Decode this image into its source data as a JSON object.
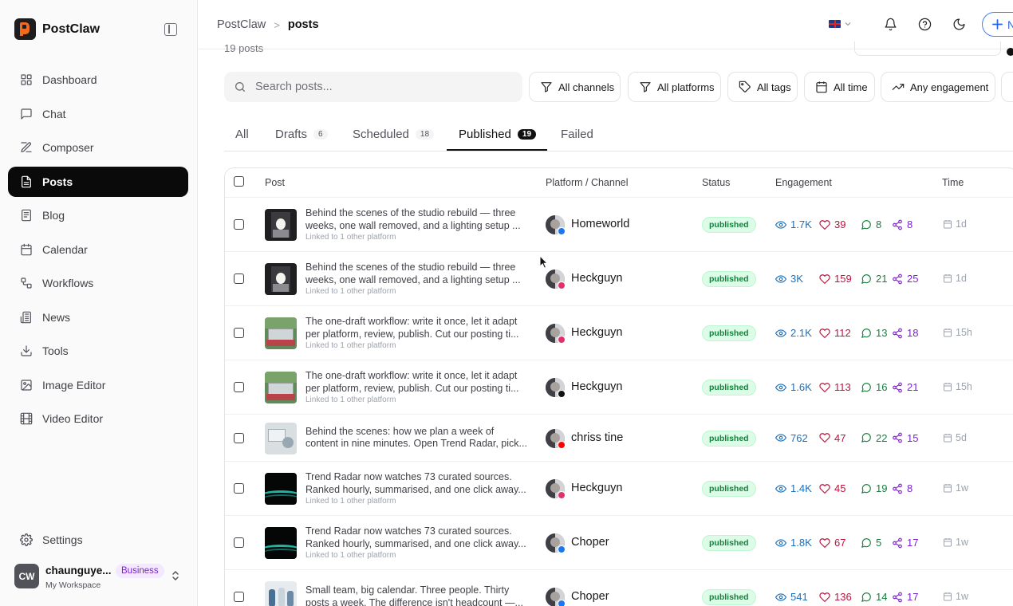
{
  "app": {
    "name": "PostClaw"
  },
  "sidebar": {
    "items": [
      {
        "label": "Dashboard",
        "icon": "dashboard-icon",
        "active": false
      },
      {
        "label": "Chat",
        "icon": "chat-icon",
        "active": false
      },
      {
        "label": "Composer",
        "icon": "composer-icon",
        "active": false
      },
      {
        "label": "Posts",
        "icon": "posts-icon",
        "active": true
      },
      {
        "label": "Blog",
        "icon": "blog-icon",
        "active": false
      },
      {
        "label": "Calendar",
        "icon": "calendar-icon",
        "active": false
      },
      {
        "label": "Workflows",
        "icon": "workflows-icon",
        "active": false
      },
      {
        "label": "News",
        "icon": "news-icon",
        "active": false
      },
      {
        "label": "Tools",
        "icon": "download-icon",
        "active": false
      },
      {
        "label": "Image Editor",
        "icon": "image-icon",
        "active": false
      },
      {
        "label": "Video Editor",
        "icon": "film-icon",
        "active": false
      }
    ],
    "settings_label": "Settings",
    "user": {
      "initials": "CW",
      "name": "chaunguye...",
      "plan": "Business",
      "workspace": "My Workspace"
    }
  },
  "topbar": {
    "breadcrumb_root": "PostClaw",
    "breadcrumb_separator": ">",
    "breadcrumb_current": "posts",
    "new_button_label": "N"
  },
  "main": {
    "post_count_partial": "19 posts",
    "search_placeholder": "Search posts...",
    "filters": [
      "All channels",
      "All platforms",
      "All tags",
      "All time",
      "Any engagement"
    ],
    "tabs": [
      {
        "label": "All",
        "count": ""
      },
      {
        "label": "Drafts",
        "count": "6"
      },
      {
        "label": "Scheduled",
        "count": "18"
      },
      {
        "label": "Published",
        "count": "19"
      },
      {
        "label": "Failed",
        "count": ""
      }
    ],
    "active_tab": "Published",
    "table": {
      "headers": [
        "Post",
        "Platform / Channel",
        "Status",
        "Engagement",
        "Time"
      ],
      "rows": [
        {
          "line1": "Behind the scenes of the studio rebuild — three",
          "line2": "weeks, one wall removed, and a lighting setup ...",
          "linked": "Linked to 1 other platform",
          "channel": "Homeworld",
          "platform": "facebook",
          "status": "published",
          "views": "1.7K",
          "likes": "39",
          "comments": "8",
          "shares": "8",
          "time": "1d",
          "thumb": "studio"
        },
        {
          "line1": "Behind the scenes of the studio rebuild — three",
          "line2": "weeks, one wall removed, and a lighting setup ...",
          "linked": "Linked to 1 other platform",
          "channel": "Heckguyn",
          "platform": "instagram",
          "status": "published",
          "views": "3K",
          "likes": "159",
          "comments": "21",
          "shares": "25",
          "time": "1d",
          "thumb": "studio"
        },
        {
          "line1": "The one-draft workflow: write it once, let it adapt",
          "line2": "per platform, review, publish. Cut our posting ti...",
          "linked": "Linked to 1 other platform",
          "channel": "Heckguyn",
          "platform": "instagram",
          "status": "published",
          "views": "2.1K",
          "likes": "112",
          "comments": "13",
          "shares": "18",
          "time": "15h",
          "thumb": "laptop"
        },
        {
          "line1": "The one-draft workflow: write it once, let it adapt",
          "line2": "per platform, review, publish. Cut our posting ti...",
          "linked": "Linked to 1 other platform",
          "channel": "Heckguyn",
          "platform": "threads",
          "status": "published",
          "views": "1.6K",
          "likes": "113",
          "comments": "16",
          "shares": "21",
          "time": "15h",
          "thumb": "laptop"
        },
        {
          "line1": "Behind the scenes: how we plan a week of",
          "line2": "content in nine minutes. Open Trend Radar, pick...",
          "linked": "",
          "channel": "chriss tine",
          "platform": "youtube",
          "status": "published",
          "views": "762",
          "likes": "47",
          "comments": "22",
          "shares": "15",
          "time": "5d",
          "thumb": "desk"
        },
        {
          "line1": "Trend Radar now watches 73 curated sources.",
          "line2": "Ranked hourly, summarised, and one click away...",
          "linked": "Linked to 1 other platform",
          "channel": "Heckguyn",
          "platform": "instagram",
          "status": "published",
          "views": "1.4K",
          "likes": "45",
          "comments": "19",
          "shares": "8",
          "time": "1w",
          "thumb": "wave"
        },
        {
          "line1": "Trend Radar now watches 73 curated sources.",
          "line2": "Ranked hourly, summarised, and one click away...",
          "linked": "Linked to 1 other platform",
          "channel": "Choper",
          "platform": "facebook",
          "status": "published",
          "views": "1.8K",
          "likes": "67",
          "comments": "5",
          "shares": "17",
          "time": "1w",
          "thumb": "wave"
        },
        {
          "line1": "Small team, big calendar. Three people. Thirty",
          "line2": "posts a week. The difference isn't headcount —...",
          "linked": "",
          "channel": "Choper",
          "platform": "facebook",
          "status": "published",
          "views": "541",
          "likes": "136",
          "comments": "14",
          "shares": "17",
          "time": "1w",
          "thumb": "team"
        }
      ]
    }
  },
  "colors": {
    "accent": "#0a0a0b",
    "link_blue": "#2563eb",
    "status_green": "#15803d",
    "views": "#1d6fb8",
    "likes": "#be123c",
    "comments": "#15803d",
    "shares": "#7e22ce",
    "facebook": "#1877f2",
    "instagram": "#e1306c",
    "youtube": "#ff0000",
    "threads": "#111111"
  }
}
